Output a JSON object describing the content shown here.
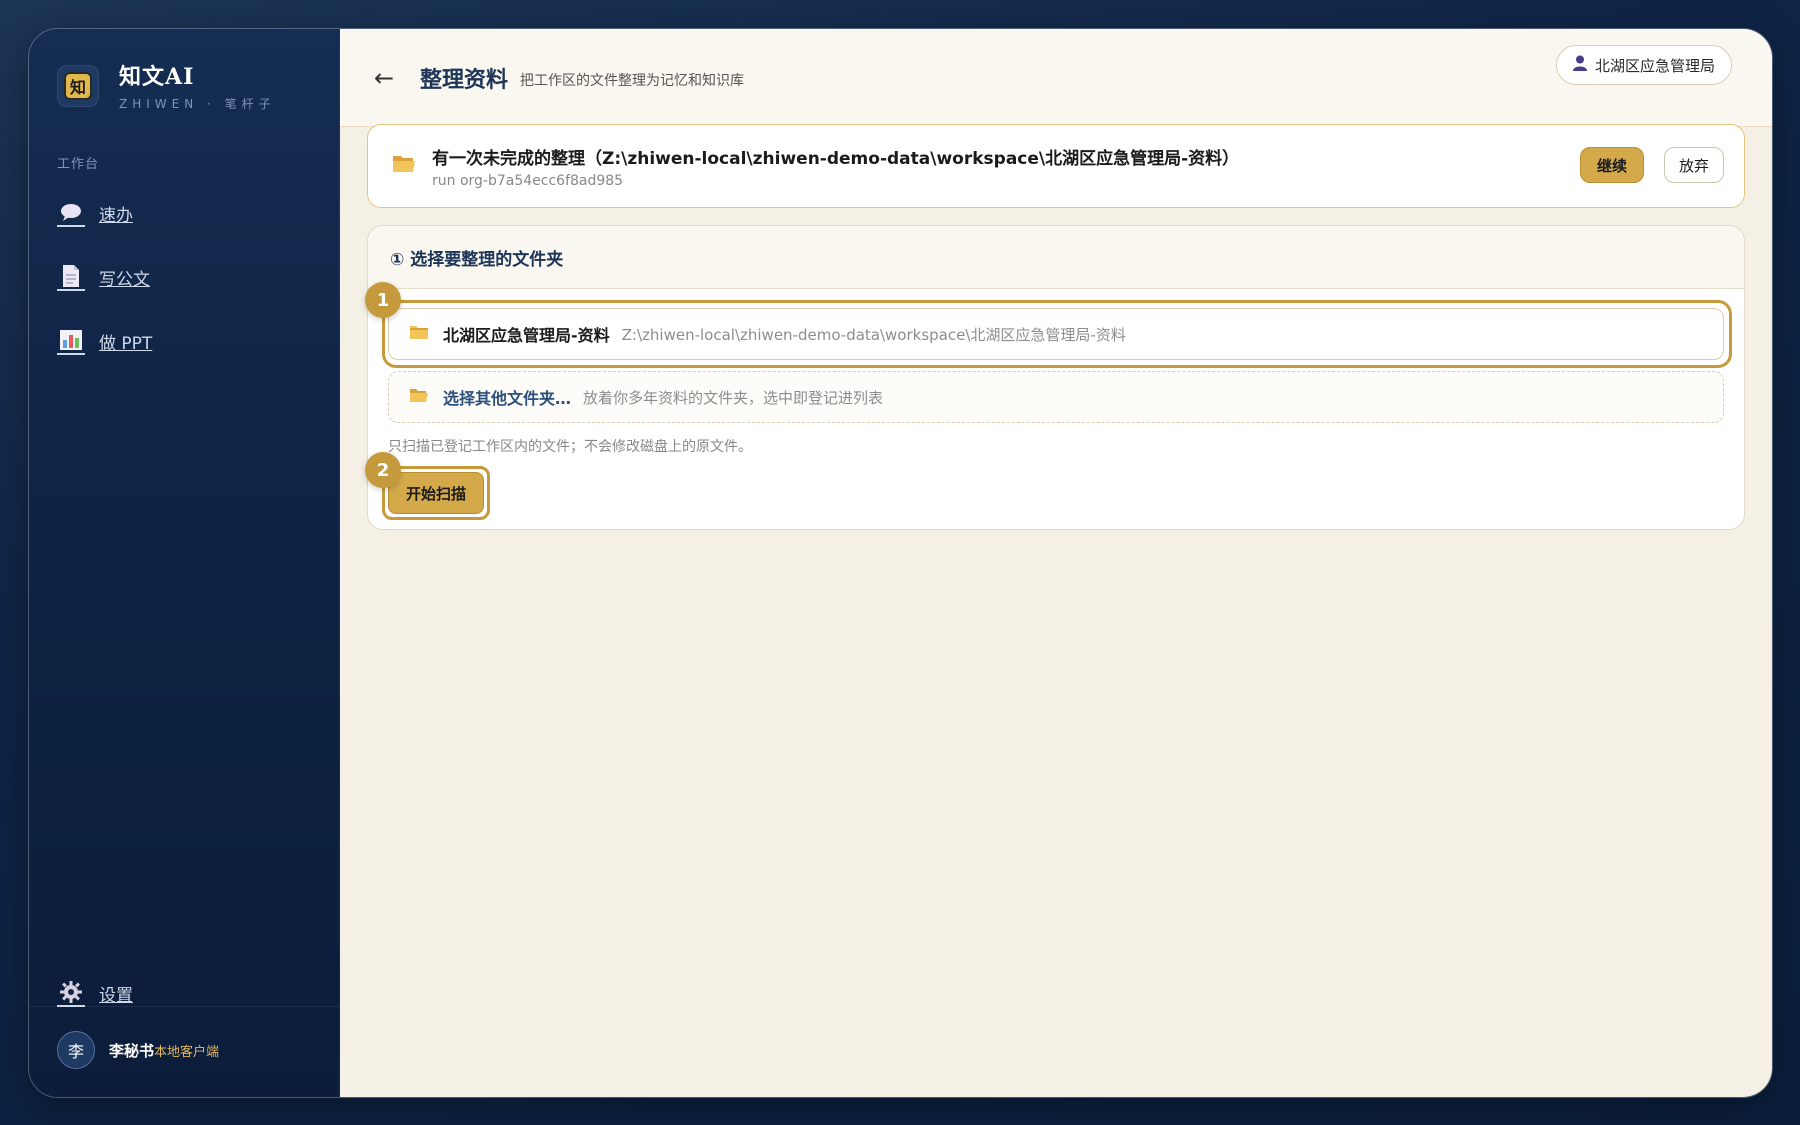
{
  "brand": {
    "name": "知文AI",
    "subtitle": "ZHIWEN · 笔杆子",
    "logo_char": "知"
  },
  "sidebar": {
    "section_label": "工作台",
    "items": [
      {
        "label": "速办",
        "icon": "chat-bubble-icon"
      },
      {
        "label": "写公文",
        "icon": "document-icon"
      },
      {
        "label": "做 PPT",
        "icon": "bar-chart-icon"
      }
    ],
    "settings_label": "设置",
    "user": {
      "avatar_char": "李",
      "name": "李秘书",
      "tag": "本地客户端"
    }
  },
  "header": {
    "back_icon": "←",
    "title": "整理资料",
    "subtitle": "把工作区的文件整理为记忆和知识库",
    "org_chip": "北湖区应急管理局"
  },
  "resume": {
    "title": "有一次未完成的整理（Z:\\zhiwen-local\\zhiwen-demo-data\\workspace\\北湖区应急管理局-资料）",
    "run": "run org-b7a54ecc6f8ad985",
    "continue_label": "继续",
    "abandon_label": "放弃"
  },
  "panel": {
    "title": "① 选择要整理的文件夹",
    "selected_folder": {
      "name": "北湖区应急管理局-资料",
      "path": "Z:\\zhiwen-local\\zhiwen-demo-data\\workspace\\北湖区应急管理局-资料"
    },
    "other_folder": {
      "name": "选择其他文件夹…",
      "desc": "放着你多年资料的文件夹，选中即登记进列表"
    },
    "hint": "只扫描已登记工作区内的文件；不会修改磁盘上的原文件。",
    "scan_label": "开始扫描"
  },
  "steps": {
    "step1": "1",
    "step2": "2"
  },
  "colors": {
    "accent": "#c59a3c",
    "button": "#d4a94a",
    "sidebar": "#0f2446",
    "main_bg": "#f5f0e5"
  }
}
